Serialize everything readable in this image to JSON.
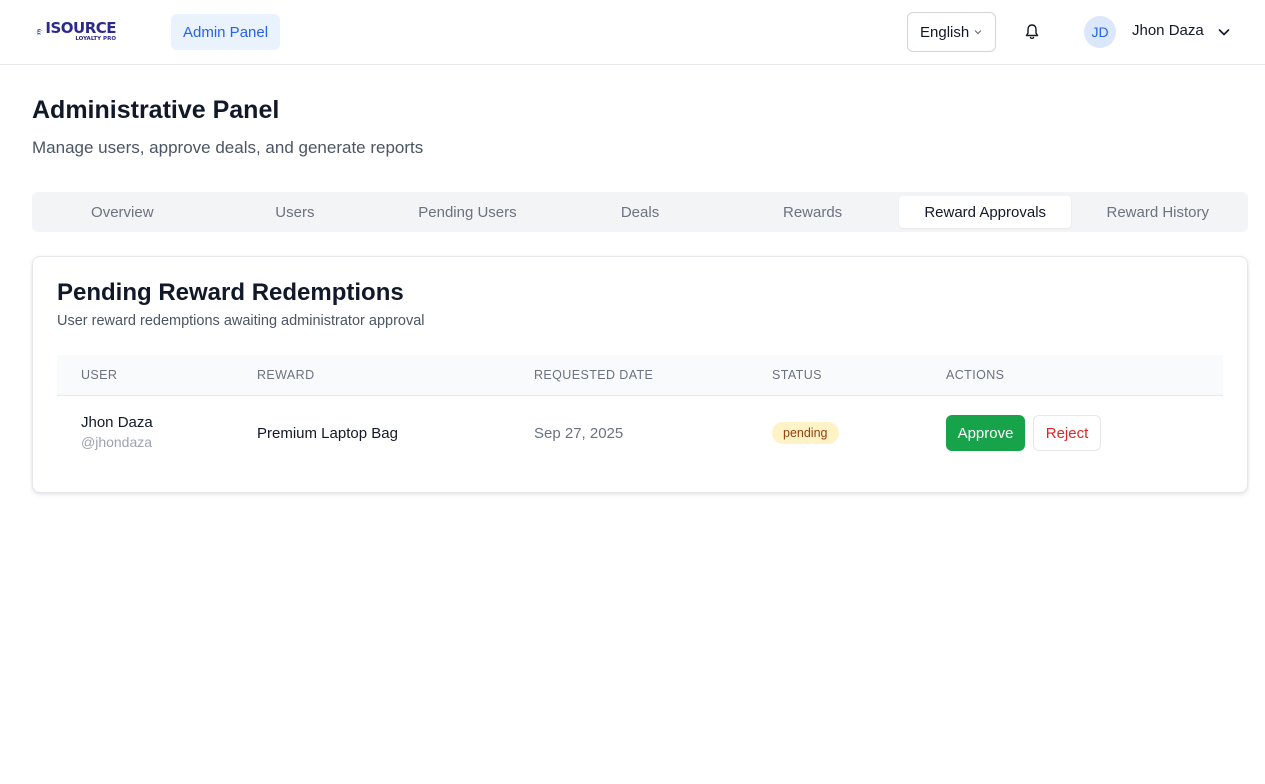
{
  "header": {
    "logo": {
      "brand": "ISOURCE",
      "tagline": "LOYALTY PRO"
    },
    "admin_label": "Admin Panel",
    "language": "English",
    "user": {
      "initials": "JD",
      "name": "Jhon Daza"
    }
  },
  "page": {
    "title": "Administrative Panel",
    "subtitle": "Manage users, approve deals, and generate reports"
  },
  "tabs": [
    {
      "label": "Overview",
      "active": false
    },
    {
      "label": "Users",
      "active": false
    },
    {
      "label": "Pending Users",
      "active": false
    },
    {
      "label": "Deals",
      "active": false
    },
    {
      "label": "Rewards",
      "active": false
    },
    {
      "label": "Reward Approvals",
      "active": true
    },
    {
      "label": "Reward History",
      "active": false
    }
  ],
  "card": {
    "title": "Pending Reward Redemptions",
    "subtitle": "User reward redemptions awaiting administrator approval",
    "columns": [
      "USER",
      "REWARD",
      "REQUESTED DATE",
      "STATUS",
      "ACTIONS"
    ],
    "rows": [
      {
        "user_name": "Jhon Daza",
        "user_handle": "@jhondaza",
        "reward": "Premium Laptop Bag",
        "requested_date": "Sep 27, 2025",
        "status": "pending",
        "approve_label": "Approve",
        "reject_label": "Reject"
      }
    ]
  },
  "colors": {
    "accent": "#2563eb",
    "approve": "#16a34a",
    "reject": "#dc2626",
    "pending_bg": "#fef3c7",
    "pending_text": "#92400e"
  }
}
